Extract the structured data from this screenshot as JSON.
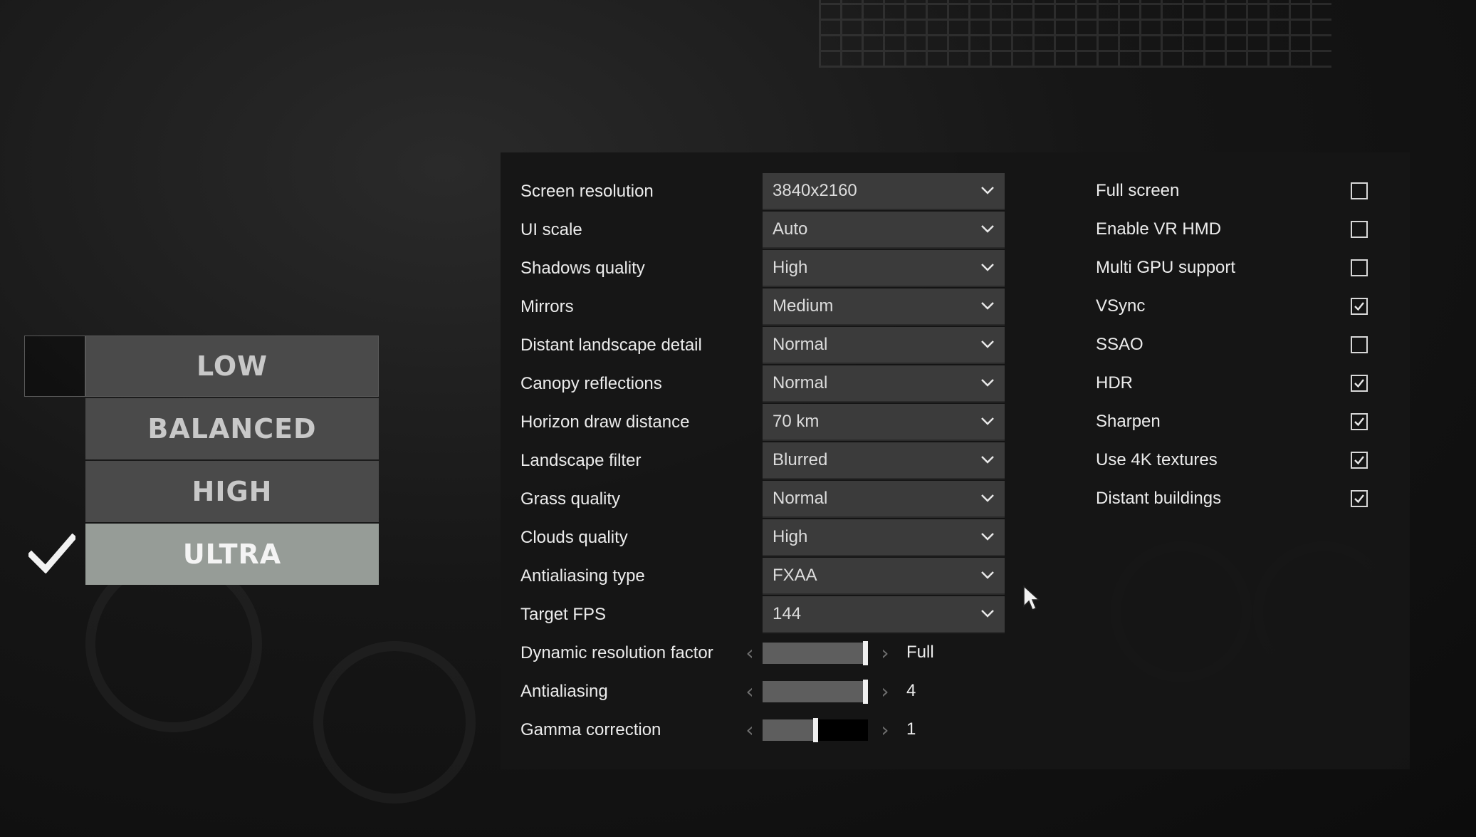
{
  "presets": {
    "items": [
      {
        "label": "LOW"
      },
      {
        "label": "BALANCED"
      },
      {
        "label": "HIGH"
      },
      {
        "label": "ULTRA"
      }
    ],
    "selected": "ULTRA",
    "selected_icon": "checkmark-icon"
  },
  "settings": {
    "dropdowns": [
      {
        "label": "Screen resolution",
        "value": "3840x2160"
      },
      {
        "label": "UI scale",
        "value": "Auto"
      },
      {
        "label": "Shadows quality",
        "value": "High"
      },
      {
        "label": "Mirrors",
        "value": "Medium"
      },
      {
        "label": "Distant landscape detail",
        "value": "Normal"
      },
      {
        "label": "Canopy reflections",
        "value": "Normal"
      },
      {
        "label": "Horizon draw distance",
        "value": "70 km"
      },
      {
        "label": "Landscape filter",
        "value": "Blurred"
      },
      {
        "label": "Grass quality",
        "value": "Normal"
      },
      {
        "label": "Clouds quality",
        "value": "High"
      },
      {
        "label": "Antialiasing type",
        "value": "FXAA"
      },
      {
        "label": "Target FPS",
        "value": "144"
      }
    ],
    "sliders": [
      {
        "label": "Dynamic resolution factor",
        "value": "Full",
        "level": 1.0
      },
      {
        "label": "Antialiasing",
        "value": "4",
        "level": 1.0
      },
      {
        "label": "Gamma correction",
        "value": "1",
        "level": 0.5
      }
    ],
    "checkboxes": [
      {
        "label": "Full screen",
        "checked": false
      },
      {
        "label": "Enable VR HMD",
        "checked": false
      },
      {
        "label": "Multi GPU support",
        "checked": false
      },
      {
        "label": "VSync",
        "checked": true
      },
      {
        "label": "SSAO",
        "checked": false
      },
      {
        "label": "HDR",
        "checked": true
      },
      {
        "label": "Sharpen",
        "checked": true
      },
      {
        "label": "Use 4K textures",
        "checked": true
      },
      {
        "label": "Distant buildings",
        "checked": true
      }
    ]
  },
  "colors": {
    "preset_button": "#4a4a4a",
    "preset_selected": "#969c97",
    "panel_bg": "#161616",
    "dropdown_bg": "#3b3b3b",
    "text": "#ececec"
  },
  "icons": {
    "dropdown": "chevron-down-icon",
    "slider_decrease": "chevron-left-icon",
    "slider_increase": "chevron-right-icon",
    "checkbox_checked": "checkmark-icon",
    "cursor": "mouse-pointer-icon"
  }
}
